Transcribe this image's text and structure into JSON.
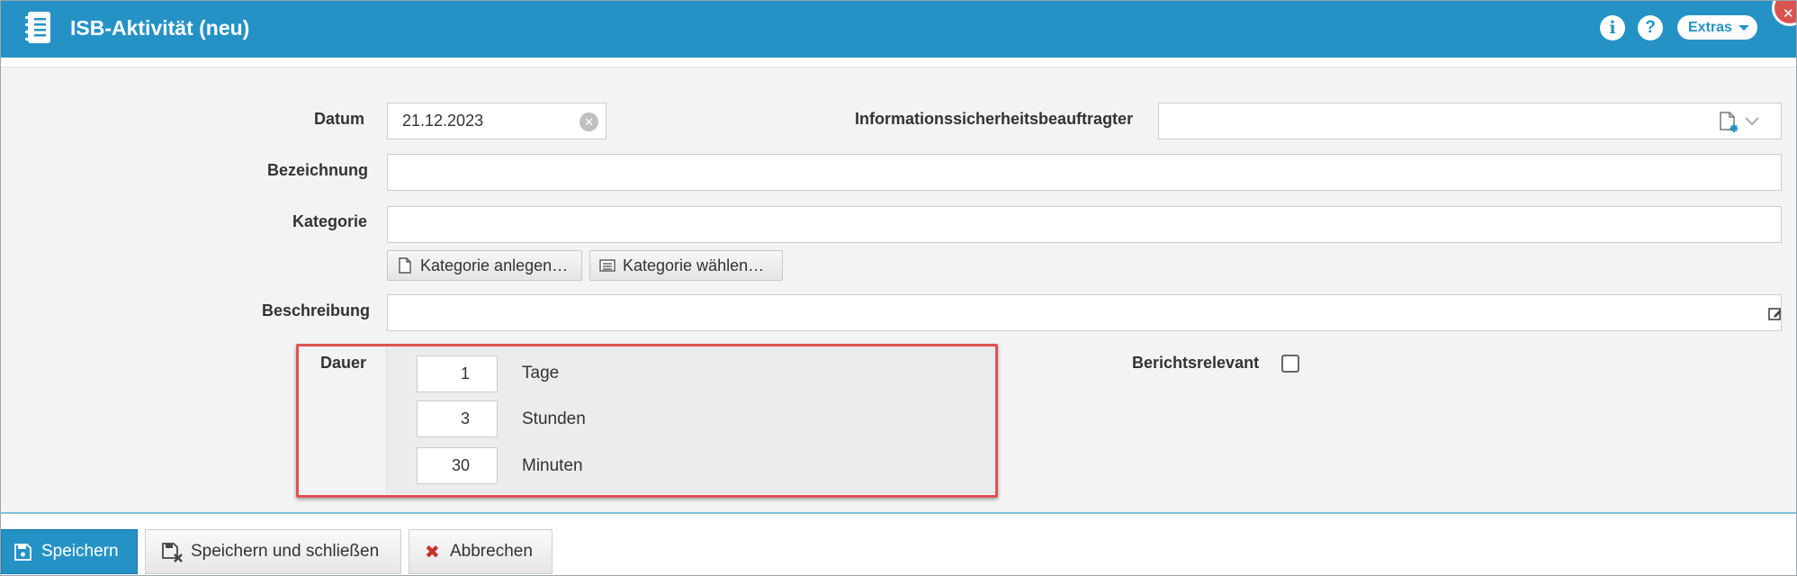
{
  "header": {
    "title": "ISB-Aktivität (neu)",
    "info_icon": "i",
    "help_icon": "?",
    "extras_label": "Extras"
  },
  "form": {
    "datum_label": "Datum",
    "datum_value": "21.12.2023",
    "isb_label": "Informationssicherheitsbeauftragter",
    "isb_value": "",
    "bezeichnung_label": "Bezeichnung",
    "bezeichnung_value": "",
    "kategorie_label": "Kategorie",
    "kategorie_value": "",
    "kategorie_anlegen_label": "Kategorie anlegen…",
    "kategorie_waehlen_label": "Kategorie wählen…",
    "beschreibung_label": "Beschreibung",
    "beschreibung_value": "",
    "dauer_label": "Dauer",
    "dauer": {
      "tage_value": "1",
      "tage_label": "Tage",
      "stunden_value": "3",
      "stunden_label": "Stunden",
      "minuten_value": "30",
      "minuten_label": "Minuten"
    },
    "berichtsrelevant_label": "Berichtsrelevant",
    "berichtsrelevant_checked": false
  },
  "footer": {
    "save_label": "Speichern",
    "save_close_label": "Speichern und schließen",
    "cancel_label": "Abbrechen"
  },
  "colors": {
    "header_bg": "#2592c6",
    "highlight": "#e05255",
    "cancel_icon": "#c9302c"
  }
}
